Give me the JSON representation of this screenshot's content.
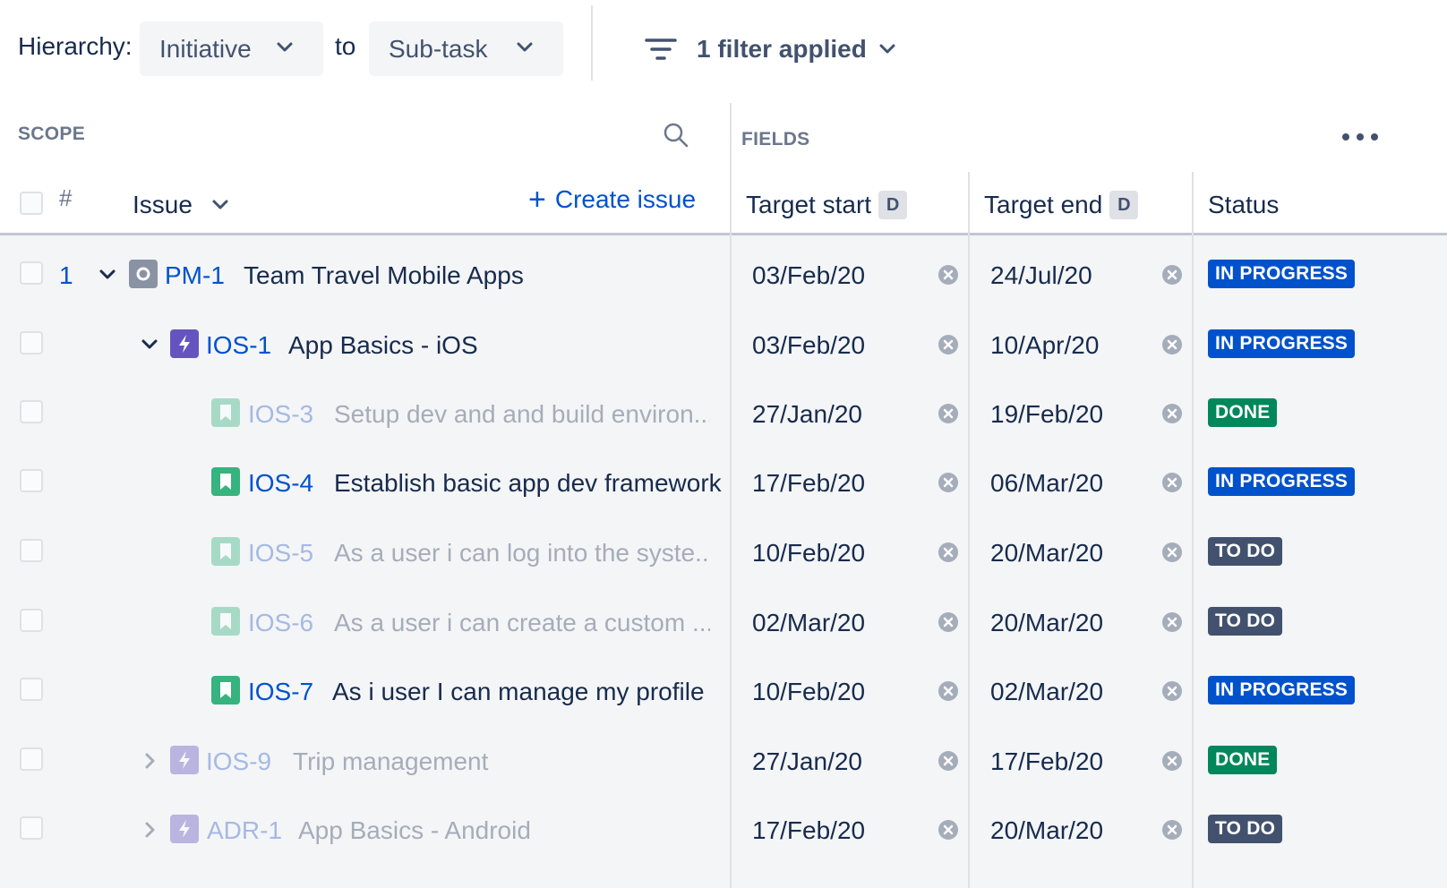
{
  "toolbar": {
    "hierarchy_label": "Hierarchy:",
    "from_value": "Initiative",
    "to_label": "to",
    "to_value": "Sub-task",
    "filter_label": "1 filter applied"
  },
  "scope": {
    "title": "SCOPE"
  },
  "fields": {
    "title": "FIELDS"
  },
  "columns": {
    "hash": "#",
    "issue": "Issue",
    "create_issue": "Create issue",
    "target_start": "Target start",
    "target_start_badge": "D",
    "target_end": "Target end",
    "target_end_badge": "D",
    "status": "Status"
  },
  "colors": {
    "link": "#0052cc",
    "initiative": "#8993a4",
    "epic": "#6554c0",
    "story": "#36b37e",
    "status_in_progress": "#0052cc",
    "status_done": "#00875a",
    "status_todo": "#42526e"
  },
  "rows": [
    {
      "num": "1",
      "key": "PM-1",
      "title": "Team Travel Mobile Apps",
      "type": "initiative-icon",
      "start": "03/Feb/20",
      "end": "24/Jul/20",
      "status": "IN PROGRESS"
    },
    {
      "num": "",
      "key": "IOS-1",
      "title": "App Basics - iOS",
      "type": "epic-icon",
      "start": "03/Feb/20",
      "end": "10/Apr/20",
      "status": "IN PROGRESS"
    },
    {
      "num": "",
      "key": "IOS-3",
      "title": "Setup dev and and build environ...",
      "type": "story-icon",
      "start": "27/Jan/20",
      "end": "19/Feb/20",
      "status": "DONE"
    },
    {
      "num": "",
      "key": "IOS-4",
      "title": "Establish basic app dev framework",
      "type": "story-icon",
      "start": "17/Feb/20",
      "end": "06/Mar/20",
      "status": "IN PROGRESS"
    },
    {
      "num": "",
      "key": "IOS-5",
      "title": "As a user i can log into the syste...",
      "type": "story-icon",
      "start": "10/Feb/20",
      "end": "20/Mar/20",
      "status": "TO DO"
    },
    {
      "num": "",
      "key": "IOS-6",
      "title": "As a user i can create a custom ...",
      "type": "story-icon",
      "start": "02/Mar/20",
      "end": "20/Mar/20",
      "status": "TO DO"
    },
    {
      "num": "",
      "key": "IOS-7",
      "title": "As i user I can manage my profile",
      "type": "story-icon",
      "start": "10/Feb/20",
      "end": "02/Mar/20",
      "status": "IN PROGRESS"
    },
    {
      "num": "",
      "key": "IOS-9",
      "title": "Trip management",
      "type": "epic-icon",
      "start": "27/Jan/20",
      "end": "17/Feb/20",
      "status": "DONE"
    },
    {
      "num": "",
      "key": "ADR-1",
      "title": "App Basics - Android",
      "type": "epic-icon",
      "start": "17/Feb/20",
      "end": "20/Mar/20",
      "status": "TO DO"
    }
  ]
}
